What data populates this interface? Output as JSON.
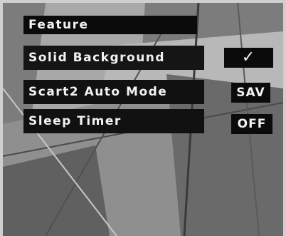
{
  "menu": {
    "title": "Feature",
    "items": [
      {
        "label": "Solid Background",
        "value": "✓"
      },
      {
        "label": "Scart2 Auto Mode",
        "value": "SAV"
      },
      {
        "label": "Sleep Timer",
        "value": "OFF"
      }
    ]
  },
  "colors": {
    "osd_background": "#0b0b0b",
    "osd_text": "#f2f2f2",
    "frame": "#cfcfcf"
  }
}
